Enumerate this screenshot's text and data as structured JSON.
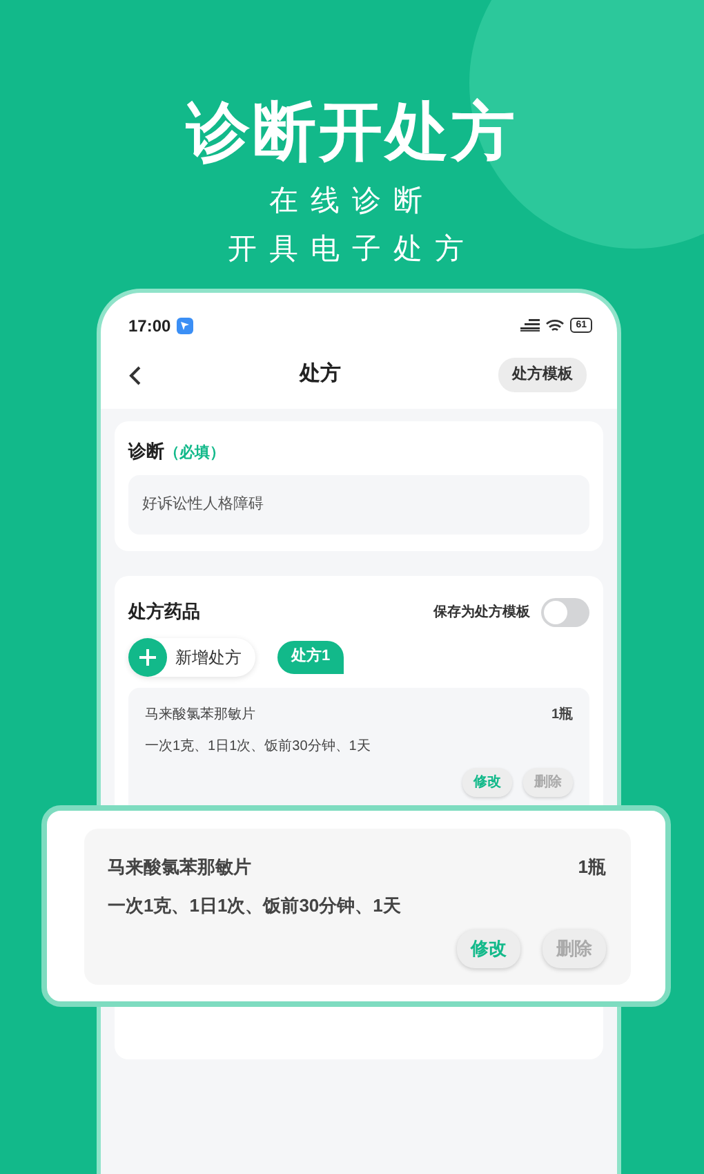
{
  "headline": "诊断开处方",
  "subtitles": [
    "在线诊断",
    "开具电子处方"
  ],
  "status_bar": {
    "time": "17:00",
    "battery": "61"
  },
  "nav": {
    "title": "处方",
    "action": "处方模板"
  },
  "diagnosis": {
    "label": "诊断",
    "required": "（必填）",
    "value": "好诉讼性人格障碍"
  },
  "prescription": {
    "title": "处方药品",
    "save_template": {
      "label": "保存为处方模板",
      "on": false
    },
    "add_label": "新增处方",
    "tabs": [
      {
        "label": "处方1",
        "selected": true
      }
    ],
    "drugs": [
      {
        "name": "马来酸氯苯那敏片",
        "quantity": "1瓶",
        "usage": "一次1克、1日1次、饭前30分钟、1天",
        "edit": "修改",
        "delete": "删除"
      }
    ]
  },
  "callout": {
    "name": "马来酸氯苯那敏片",
    "quantity": "1瓶",
    "usage": "一次1克、1日1次、饭前30分钟、1天",
    "edit": "修改",
    "delete": "删除"
  }
}
